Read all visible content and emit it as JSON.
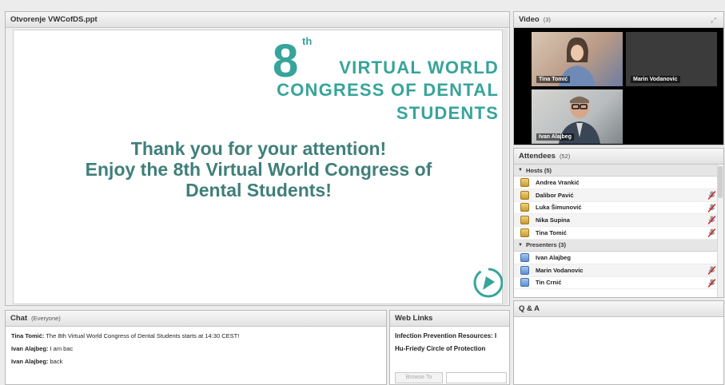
{
  "share": {
    "title": "Otvorenje VWCofDS.ppt",
    "slide": {
      "logo_number": "8",
      "logo_suffix": "th",
      "logo_line1": "VIRTUAL WORLD",
      "logo_line2": "CONGRESS OF DENTAL",
      "logo_line3": "STUDENTS",
      "message_line1": "Thank you for your attention!",
      "message_line2": "Enjoy the 8th Virtual World Congress of",
      "message_line3": "Dental Students!"
    }
  },
  "video": {
    "title": "Video",
    "count": "(3)",
    "feeds": [
      {
        "name": "Tina Tomić"
      },
      {
        "name": "Marin Vodanovic"
      },
      {
        "name": "Ivan Alajbeg"
      }
    ]
  },
  "attendees": {
    "title": "Attendees",
    "count": "(52)",
    "hosts_label": "Hosts (5)",
    "hosts": [
      {
        "name": "Andrea Vrankić",
        "mic": false
      },
      {
        "name": "Dalibor Pavić",
        "mic": true
      },
      {
        "name": "Luka Šimunović",
        "mic": true
      },
      {
        "name": "Nika Supina",
        "mic": true
      },
      {
        "name": "Tina Tomić",
        "mic": true
      }
    ],
    "presenters_label": "Presenters (3)",
    "presenters": [
      {
        "name": "Ivan Alajbeg",
        "mic": false
      },
      {
        "name": "Marin Vodanovic",
        "mic": true
      },
      {
        "name": "Tin Crnić",
        "mic": true
      }
    ]
  },
  "chat": {
    "title": "Chat",
    "scope": "(Everyone)",
    "messages": [
      {
        "author": "Tina Tomić:",
        "text": " The 8th Virtual World Congress of Dental Students starts at 14:30 CEST!"
      },
      {
        "author": "Ivan Alajbeg:",
        "text": " I am bac"
      },
      {
        "author": "Ivan Alajbeg:",
        "text": " back"
      }
    ]
  },
  "weblinks": {
    "title": "Web Links",
    "links": [
      "Infection Prevention Resources: I",
      "Hu-Friedy Circle of Protection"
    ],
    "browse_label": "Browse To"
  },
  "qa": {
    "title": "Q & A"
  },
  "colors": {
    "brand_teal": "#37a49a",
    "slide_text": "#3f7f7a"
  }
}
